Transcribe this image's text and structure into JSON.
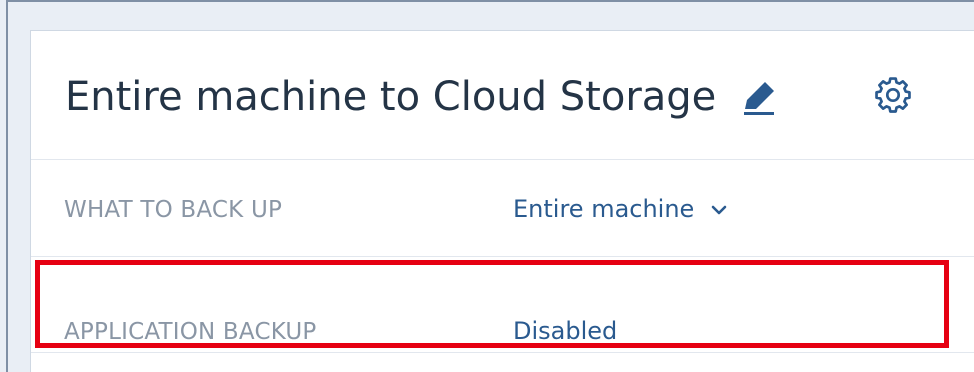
{
  "card": {
    "title": "Entire machine to Cloud Storage",
    "icons": {
      "edit": "pencil-icon",
      "settings": "gear-icon",
      "dropdown": "chevron-down-icon"
    }
  },
  "rows": [
    {
      "label": "WHAT TO BACK UP",
      "value": "Entire machine"
    },
    {
      "label": "APPLICATION BACKUP",
      "value": "Disabled"
    }
  ],
  "colors": {
    "title": "#243446",
    "label": "#8a96a5",
    "value": "#2a5a8f",
    "icon": "#2a5a8f",
    "highlight": "#e60012"
  }
}
